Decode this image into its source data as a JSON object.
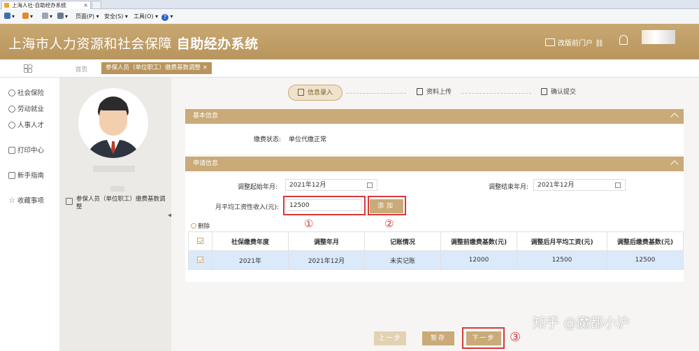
{
  "browser": {
    "tab_title": "上海人社-自助经办系统",
    "tab_close": "×",
    "toolbar": [
      "页面(P) ▾",
      "安全(S) ▾",
      "工具(O) ▾"
    ],
    "help": "?"
  },
  "header": {
    "title_plain": "上海市人力资源和社会保障",
    "title_bold": "自助经办系统",
    "portal_link": "改版前门户"
  },
  "breadcrumb": {
    "home": "首页",
    "current_tab": "参保人员（单位职工）缴费基数调整 ×"
  },
  "sidebar": {
    "items": [
      {
        "label": "社会保险",
        "icon": "shield-icon"
      },
      {
        "label": "劳动就业",
        "icon": "person-icon"
      },
      {
        "label": "人事人才",
        "icon": "people-icon"
      },
      {
        "label": "打印中心",
        "icon": "printer-icon"
      },
      {
        "label": "新手指南",
        "icon": "guide-icon"
      },
      {
        "label": "收藏事项",
        "icon": "star-icon"
      }
    ]
  },
  "profile": {
    "menu_item": "参保人员（单位职工）缴费基数调整"
  },
  "steps": [
    {
      "label": "信息录入",
      "active": true
    },
    {
      "label": "资料上传",
      "active": false
    },
    {
      "label": "确认提交",
      "active": false
    }
  ],
  "basic_info": {
    "title": "基本信息",
    "status_label": "缴费状态:",
    "status_value": "单位代缴正常"
  },
  "application": {
    "title": "申请信息",
    "start_label": "调整起始年月:",
    "start_value": "2021年12月",
    "end_label": "调整结束年月:",
    "end_value": "2021年12月",
    "income_label": "月平均工资性收入(元):",
    "income_value": "12500",
    "add_button": "添加",
    "delete_label": "删除"
  },
  "annotations": {
    "one": "①",
    "two": "②",
    "three": "③"
  },
  "table": {
    "headers": [
      "社保缴费年度",
      "调整年月",
      "记账情况",
      "调整前缴费基数(元)",
      "调整后月平均工资(元)",
      "调整后缴费基数(元)"
    ],
    "rows": [
      [
        "2021年",
        "2021年12月",
        "未实记账",
        "12000",
        "12500",
        "12500"
      ]
    ]
  },
  "actions": {
    "prev": "上一步",
    "save": "暂存",
    "next": "下一步"
  },
  "watermark": "知乎 @魔都小沪",
  "colors": {
    "brand": "#b8955d",
    "accent": "#c9aa78",
    "annotation": "#d63a3a",
    "selected_row": "#dbeafb"
  }
}
